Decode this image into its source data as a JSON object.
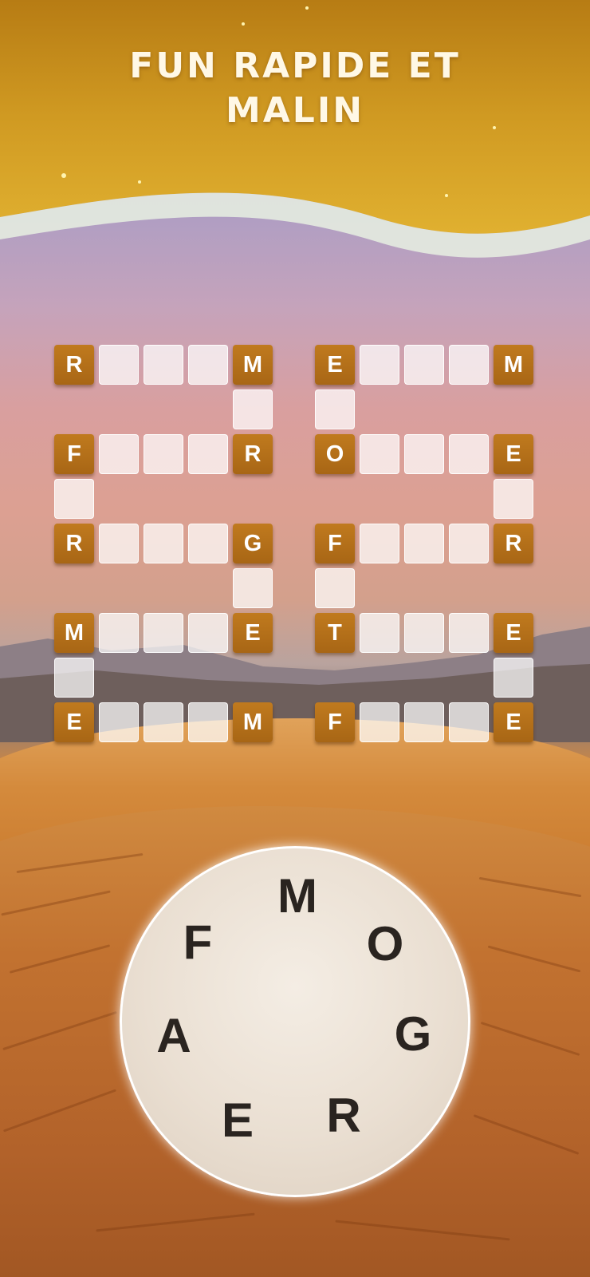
{
  "title": {
    "line1": "FUN RAPIDE ET",
    "line2": "MALIN"
  },
  "board": {
    "left_block": [
      {
        "row": 0,
        "letters": [
          "R",
          "",
          "",
          "",
          "M"
        ]
      },
      {
        "row": 2,
        "letters": [
          "F",
          "",
          "",
          "",
          "R"
        ]
      },
      {
        "row": 4,
        "letters": [
          "R",
          "",
          "",
          "",
          "G"
        ]
      },
      {
        "row": 6,
        "letters": [
          "M",
          "",
          "",
          "",
          "E"
        ]
      },
      {
        "row": 8,
        "letters": [
          "E",
          "",
          "",
          "",
          "M"
        ]
      }
    ],
    "right_block": [
      {
        "row": 0,
        "letters": [
          "E",
          "",
          "",
          "",
          "M"
        ]
      },
      {
        "row": 2,
        "letters": [
          "O",
          "",
          "",
          "",
          "E"
        ]
      },
      {
        "row": 4,
        "letters": [
          "F",
          "",
          "",
          "",
          "R"
        ]
      },
      {
        "row": 6,
        "letters": [
          "T",
          "",
          "",
          "",
          "E"
        ]
      },
      {
        "row": 8,
        "letters": [
          "F",
          "",
          "",
          "",
          "E"
        ]
      }
    ]
  },
  "wheel": {
    "letters": {
      "top": "M",
      "upper_right": "O",
      "upper_left": "F",
      "right": "G",
      "left": "A",
      "bottom_right": "R",
      "bottom_left": "E"
    }
  },
  "colors": {
    "tile": "#b06e18",
    "header": "#c98a1c",
    "wave": "#eaf3e2"
  }
}
